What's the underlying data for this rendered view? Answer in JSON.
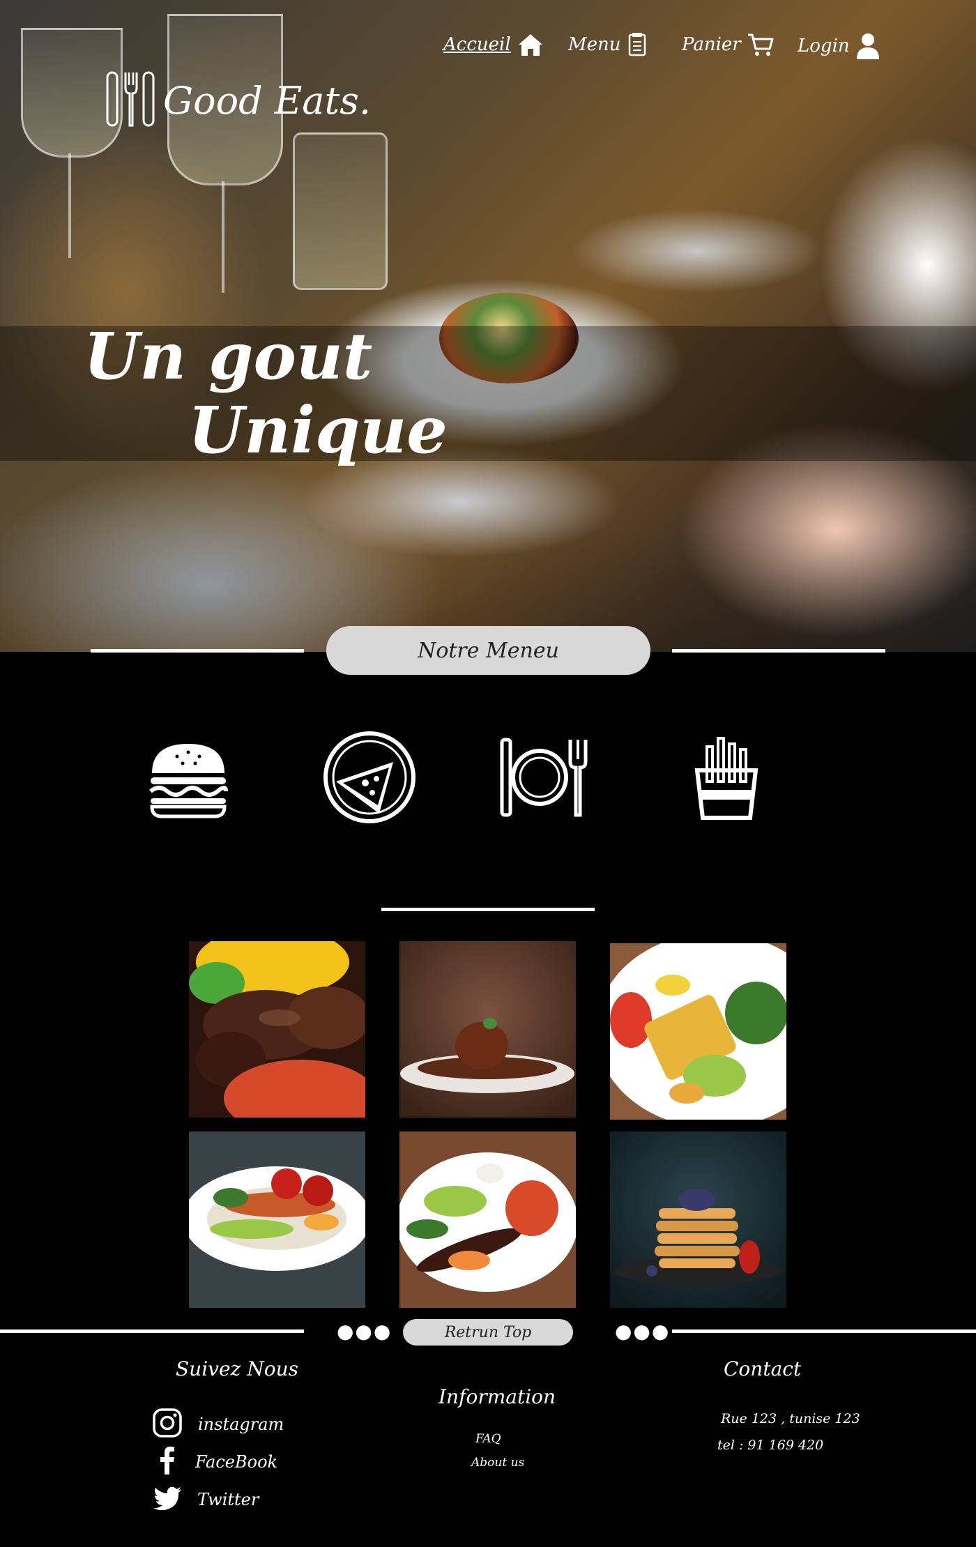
{
  "brand": {
    "name": "Good Eats.",
    "icon": "utensils-icon"
  },
  "nav": [
    {
      "label": "Accueil",
      "icon": "home-icon",
      "active": true
    },
    {
      "label": "Menu",
      "icon": "menu-icon"
    },
    {
      "label": "Panier",
      "icon": "cart-icon"
    },
    {
      "label": "Login",
      "icon": "user-icon"
    }
  ],
  "hero": {
    "tagline_line1": "Un gout",
    "tagline_line2": "Unique"
  },
  "menu_section": {
    "button_label": "Notre Meneu",
    "categories": [
      {
        "name": "burger",
        "icon": "burger-icon"
      },
      {
        "name": "pizza",
        "icon": "pizza-icon"
      },
      {
        "name": "plat",
        "icon": "plate-cutlery-icon"
      },
      {
        "name": "frites",
        "icon": "fries-icon"
      }
    ]
  },
  "gallery": [
    {
      "dish": "grilled-meat",
      "colors": [
        "#f2c21a",
        "#4a2418",
        "#d54a2a"
      ]
    },
    {
      "dish": "meat-stew",
      "colors": [
        "#5a3a2c",
        "#e8e4df",
        "#6a2c14"
      ]
    },
    {
      "dish": "vegetable-skewer",
      "colors": [
        "#ffffff",
        "#e8b43a",
        "#e03a2a"
      ]
    },
    {
      "dish": "kebab-plate",
      "colors": [
        "#3a4348",
        "#ffffff",
        "#c85a2a"
      ]
    },
    {
      "dish": "beef-plate",
      "colors": [
        "#7a4a30",
        "#ffffff",
        "#d84a2a"
      ]
    },
    {
      "dish": "pancakes",
      "colors": [
        "#1c2c33",
        "#e8a858",
        "#c0201a"
      ]
    }
  ],
  "footer": {
    "return_top_label": "Retrun Top",
    "follow_title": "Suivez Nous",
    "social": [
      {
        "label": "instagram",
        "icon": "instagram-icon"
      },
      {
        "label": "FaceBook",
        "icon": "facebook-icon"
      },
      {
        "label": "Twitter",
        "icon": "twitter-icon"
      }
    ],
    "info_title": "Information",
    "info_links": [
      "FAQ",
      "About us"
    ],
    "contact_title": "Contact",
    "contact_lines": [
      "Rue 123 , tunise 123",
      "tel : 91 169 420"
    ]
  }
}
